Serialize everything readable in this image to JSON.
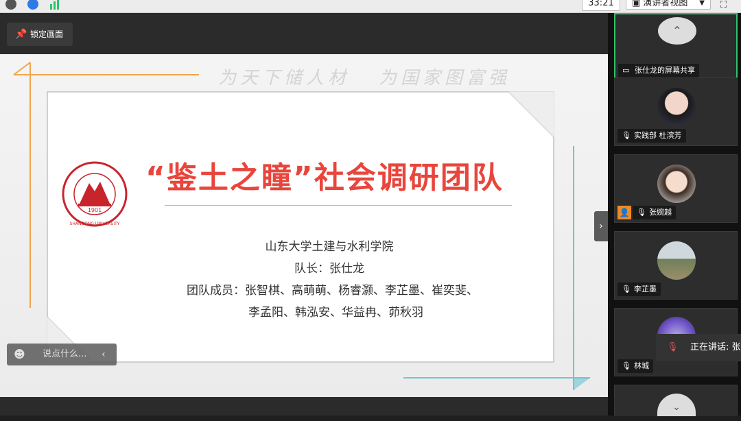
{
  "topbar": {
    "timer": "33:21",
    "view_label": "演讲者视图",
    "colors": {
      "info": "#555555",
      "shield": "#2f7be5",
      "signal": "#2fc46a"
    }
  },
  "stage": {
    "lock_label": "锁定画面",
    "chat_placeholder": "说点什么...",
    "collapse_icon": "chevron-right-icon"
  },
  "slide": {
    "motto_left": "为天下储人材",
    "motto_right": "为国家图富强",
    "title": "“鉴土之瞳”社会调研团队",
    "line1": "山东大学土建与水利学院",
    "line2": "队长：张仕龙",
    "line3": "团队成员：张智棋、高萌萌、杨睿灏、李芷墨、崔奕斐、",
    "line4": "李孟阳、韩泓安、华益冉、茆秋羽",
    "logo_year": "1901",
    "logo_text": "SHANDONG UNIVERSITY",
    "accent": "#e8453c"
  },
  "participants": [
    {
      "name": "张仕龙的屏幕共享",
      "active": true
    },
    {
      "name": "实践部 杜滨芳"
    },
    {
      "name": "张婉越"
    },
    {
      "name": "李芷墨"
    },
    {
      "name": "林城"
    }
  ],
  "speaking": "正在讲话: 张"
}
